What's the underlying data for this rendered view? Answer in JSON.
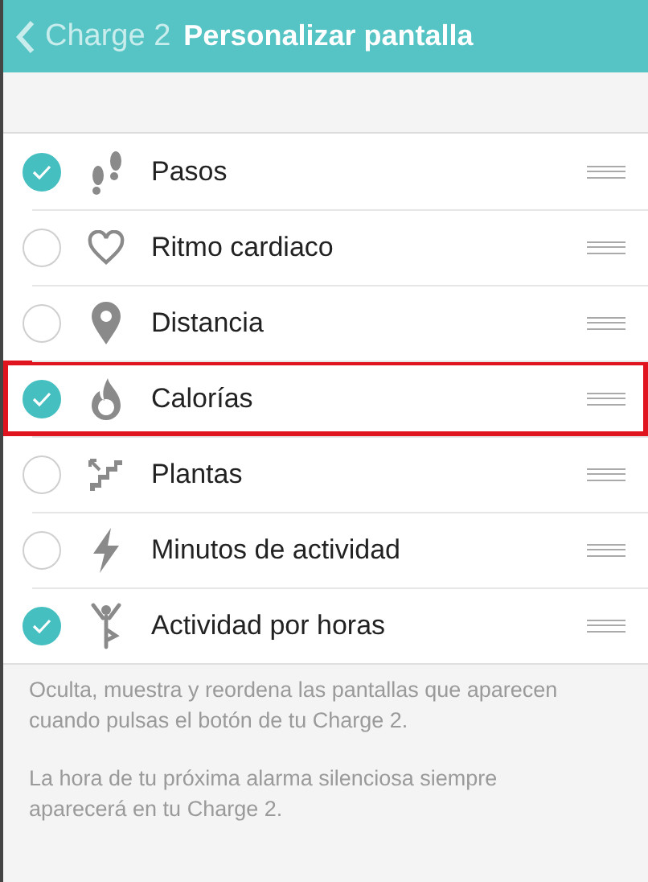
{
  "header": {
    "back_label": "Charge 2",
    "title": "Personalizar pantalla"
  },
  "screens": [
    {
      "label": "Pasos",
      "kind": "steps",
      "checked": true,
      "highlighted": false
    },
    {
      "label": "Ritmo cardiaco",
      "kind": "heart",
      "checked": false,
      "highlighted": false
    },
    {
      "label": "Distancia",
      "kind": "distance",
      "checked": false,
      "highlighted": false
    },
    {
      "label": "Calorías",
      "kind": "calories",
      "checked": true,
      "highlighted": true
    },
    {
      "label": "Plantas",
      "kind": "floors",
      "checked": false,
      "highlighted": false
    },
    {
      "label": "Minutos de actividad",
      "kind": "active",
      "checked": false,
      "highlighted": false
    },
    {
      "label": "Actividad por horas",
      "kind": "hourly",
      "checked": true,
      "highlighted": false
    }
  ],
  "notes": [
    "Oculta, muestra y reordena las pantallas que aparecen cuando pulsas el botón de tu Charge 2.",
    "La hora de tu próxima alarma silenciosa siempre aparecerá en tu Charge 2."
  ]
}
